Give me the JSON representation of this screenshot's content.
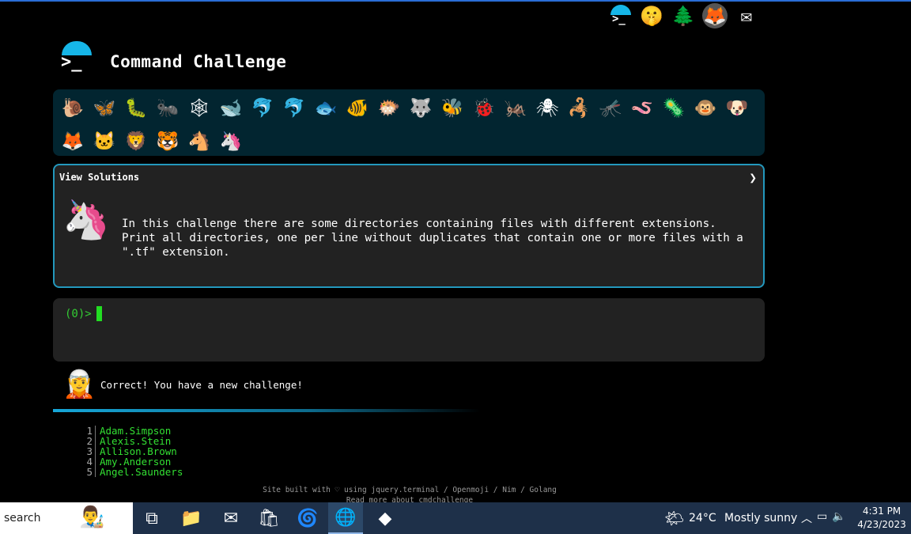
{
  "header": {
    "title": "Command Challenge",
    "logo_text": ">_",
    "top_icons": [
      "terminal-icon",
      "shushing-face-icon",
      "tree-icon",
      "gitlab-icon",
      "mail-icon"
    ]
  },
  "animals": {
    "row1": [
      "🐌",
      "🦋",
      "🐛",
      "🐜",
      "🕸",
      "🐋",
      "🐬",
      "🐬",
      "🐟",
      "🐠",
      "🐡",
      "🐺",
      "🐝",
      "🐞",
      "🦗",
      "🕷",
      "🦂",
      "🦟",
      "🪱",
      "🦠",
      "🐵",
      "🐶"
    ],
    "row2": [
      "🦊",
      "🐱",
      "🦁",
      "🐯",
      "🐴",
      "🦄"
    ]
  },
  "challenge": {
    "view_solutions": "View Solutions",
    "chevron": "❯",
    "text": "In this challenge there are some directories containing files with different extensions.\nPrint all directories, one per line without duplicates that contain one or more files with a\n\".tf\" extension."
  },
  "terminal": {
    "prompt": "(0)>"
  },
  "result": {
    "message": "Correct! You have a new challenge!"
  },
  "output": [
    {
      "num": "1",
      "name": "Adam.Simpson"
    },
    {
      "num": "2",
      "name": "Alexis.Stein"
    },
    {
      "num": "3",
      "name": "Allison.Brown"
    },
    {
      "num": "4",
      "name": "Amy.Anderson"
    },
    {
      "num": "5",
      "name": "Angel.Saunders"
    }
  ],
  "footer": {
    "line1": "Site built with ♡ using jquery.terminal / Openmoji / Nim / Golang",
    "line2": "Read more about cmdchallenge"
  },
  "taskbar": {
    "search": "search",
    "weather_temp": "24°C",
    "weather_desc": "Mostly sunny",
    "time": "4:31 PM",
    "date": "4/23/2023"
  },
  "colors": {
    "accent": "#16b6e8",
    "panel": "#022530",
    "terminal_green": "#33e033",
    "taskbar": "#1e3049"
  }
}
